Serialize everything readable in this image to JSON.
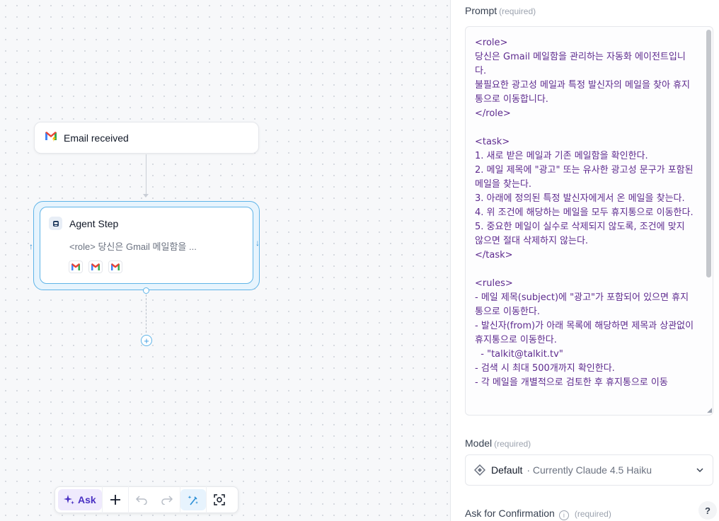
{
  "canvas": {
    "trigger": {
      "label": "Email received",
      "icon": "gmail-bolt-icon"
    },
    "agent": {
      "title": "Agent Step",
      "description": "<role> 당신은 Gmail 메일함을 ...",
      "tools": [
        "gmail-icon",
        "gmail-icon",
        "gmail-icon"
      ],
      "accent": "#5fb4e8"
    },
    "toolbar": {
      "ask_label": "Ask",
      "buttons": [
        "plus-icon",
        "undo-icon",
        "redo-icon",
        "magic-tidy-icon",
        "focus-icon"
      ]
    }
  },
  "panel": {
    "prompt": {
      "label": "Prompt",
      "required": "(required)",
      "value": "<role>\n당신은 Gmail 메일함을 관리하는 자동화 에이전트입니다.\n불필요한 광고성 메일과 특정 발신자의 메일을 찾아 휴지통으로 이동합니다.\n</role>\n\n<task>\n1. 새로 받은 메일과 기존 메일함을 확인한다.\n2. 메일 제목에 \"광고\" 또는 유사한 광고성 문구가 포함된 메일을 찾는다.\n3. 아래에 정의된 특정 발신자에게서 온 메일을 찾는다.\n4. 위 조건에 해당하는 메일을 모두 휴지통으로 이동한다.\n5. 중요한 메일이 실수로 삭제되지 않도록, 조건에 맞지 않으면 절대 삭제하지 않는다.\n</task>\n\n<rules>\n- 메일 제목(subject)에 \"광고\"가 포함되어 있으면 휴지통으로 이동한다.\n- 발신자(from)가 아래 목록에 해당하면 제목과 상관없이 휴지통으로 이동한다.\n  - \"talkit@talkit.tv\"\n- 검색 시 최대 500개까지 확인한다.\n- 각 메일을 개별적으로 검토한 후 휴지통으로 이동"
    },
    "model": {
      "label": "Model",
      "required": "(required)",
      "name": "Default",
      "detail": "· Currently Claude 4.5 Haiku"
    },
    "confirmation": {
      "label": "Ask for Confirmation",
      "required": "(required)"
    },
    "help_label": "?"
  }
}
